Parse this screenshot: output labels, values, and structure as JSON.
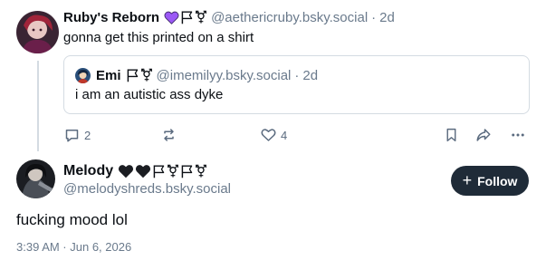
{
  "post": {
    "author": {
      "display_name": "Ruby's Reborn",
      "handle": "@aethericruby.bsky.social",
      "emojis": [
        "purple-heart-icon",
        "flag-icon",
        "transgender-symbol-icon"
      ]
    },
    "separator": "·",
    "time": "2d",
    "text": "gonna get this printed on a shirt",
    "quote": {
      "author": {
        "display_name": "Emi",
        "handle": "@imemilyy.bsky.social",
        "emojis": [
          "flag-icon",
          "transgender-symbol-icon"
        ]
      },
      "time": "2d",
      "text": "i am an autistic ass dyke"
    },
    "actions": {
      "reply_count": "2",
      "repost_count": "",
      "like_count": "4",
      "icons": [
        "reply-icon",
        "repost-icon",
        "like-icon",
        "bookmark-icon",
        "share-icon",
        "more-icon"
      ]
    }
  },
  "focused_post": {
    "author": {
      "display_name": "Melody",
      "handle": "@melodyshreds.bsky.social",
      "emojis": [
        "black-heart-icon",
        "black-heart-icon",
        "flag-icon",
        "transgender-symbol-icon",
        "flag-icon",
        "transgender-symbol-icon"
      ]
    },
    "follow_label": "Follow",
    "text": "fucking mood lol",
    "timestamp": "3:39 AM · Jun 6, 2026"
  },
  "colors": {
    "text": "#0b0f14",
    "muted": "#6a7a8c",
    "action_icon": "#5b6b7f",
    "border": "#d4dbe2",
    "follow_bg": "#1f2b38",
    "purple_heart": "#9b59f5"
  }
}
